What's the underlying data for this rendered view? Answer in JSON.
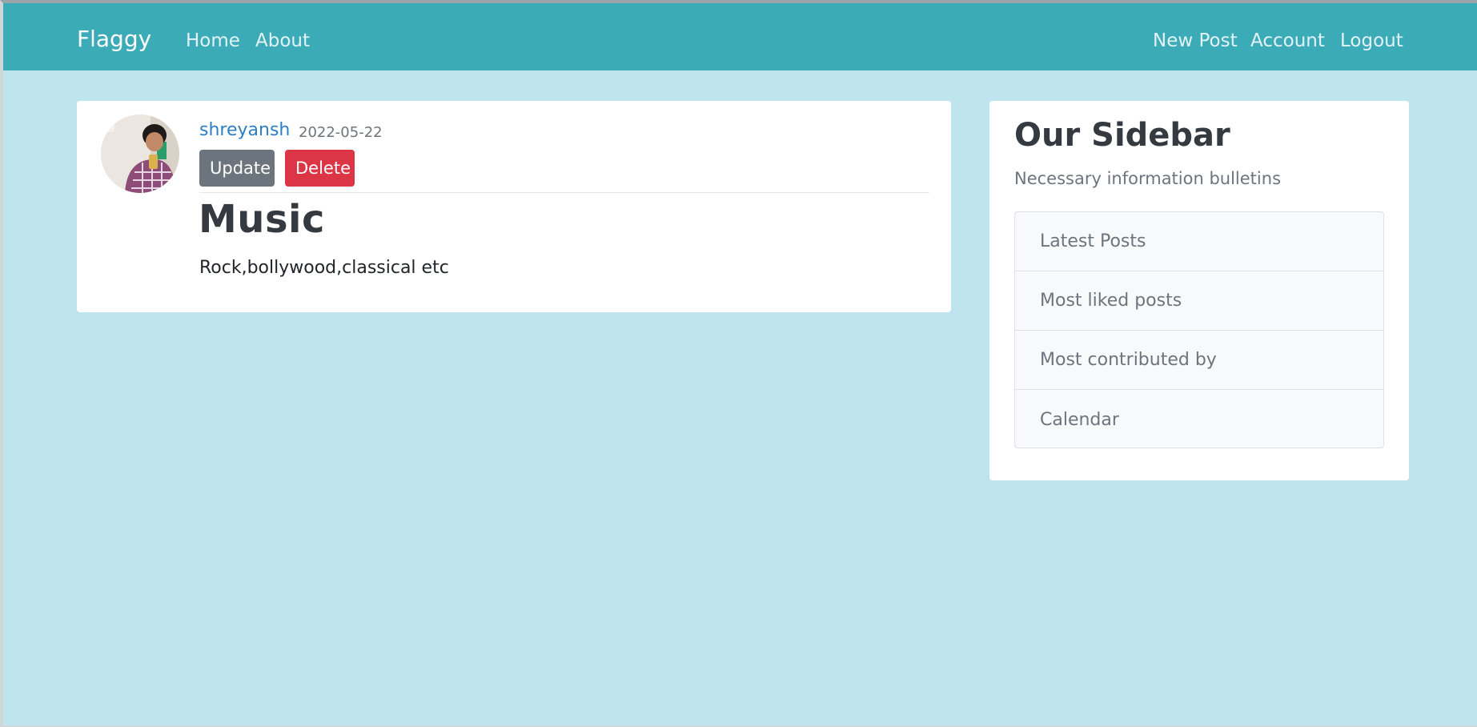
{
  "navbar": {
    "brand": "Flaggy",
    "left_links": [
      "Home",
      "About"
    ],
    "right_links": [
      "New Post",
      "Account",
      "Logout"
    ]
  },
  "post": {
    "author": "shreyansh",
    "date": "2022-05-22",
    "update_label": "Update",
    "delete_label": "Delete",
    "title": "Music",
    "content": "Rock,bollywood,classical etc"
  },
  "sidebar": {
    "title": "Our Sidebar",
    "subtitle": "Necessary information bulletins",
    "items": [
      "Latest Posts",
      "Most liked posts",
      "Most contributed by",
      "Calendar"
    ]
  },
  "colors": {
    "navbar": "#3cabb8",
    "background": "#bee5ee",
    "link": "#2c7fc6",
    "update_button": "#6c757d",
    "delete_button": "#dc3545"
  }
}
